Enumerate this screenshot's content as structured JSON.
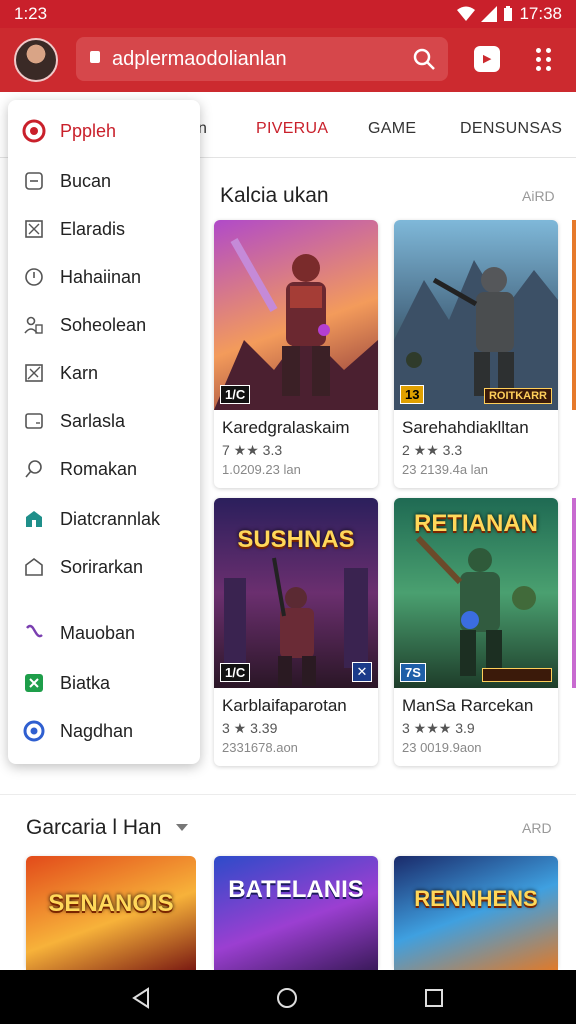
{
  "status": {
    "time_left": "1:23",
    "time_right": "17:38"
  },
  "appbar": {
    "url": "adplermaodolianlan",
    "store_label": ""
  },
  "tabs": [
    {
      "label": "PIVERUA"
    },
    {
      "label": "GAME"
    },
    {
      "label": "DENSUNSAS"
    }
  ],
  "tab_partial": "n",
  "section1": {
    "title": "Kalcia ukan",
    "more": "AiRD"
  },
  "section2": {
    "title": "Garcaria l Han",
    "more": "ARD"
  },
  "cards": [
    {
      "name": "Karedgralaskaim",
      "rating": "7 ★★ 3.3",
      "meta": "1.0209.23 lan",
      "badge": "1/C",
      "badge2": ""
    },
    {
      "name": "Sarehahdiaklltan",
      "rating": "2 ★★ 3.3",
      "meta": "23 2139.4a lan",
      "badge": "13",
      "badge2": "ROITKARR"
    },
    {
      "name": "Karblaifaparotan",
      "rating": "3 ★ 3.39",
      "meta": "2331678.aon",
      "badge": "1/C",
      "badge2": "",
      "art_title": "SUSHNAS"
    },
    {
      "name": "ManSa Rarcekan",
      "rating": "3 ★★★ 3.9",
      "meta": "23 0019.9aon",
      "badge": "7S",
      "badge2": "",
      "art_title": "RETIANAN"
    },
    {
      "art_title": "SENANOIS"
    },
    {
      "art_title": "BATELANIS"
    },
    {
      "art_title": "RENNHENS"
    }
  ],
  "drawer": {
    "items": [
      {
        "label": "Pppleh",
        "icon": "brand-icon"
      },
      {
        "label": "Bucan",
        "icon": "bookmark-icon"
      },
      {
        "label": "Elaradis",
        "icon": "box-icon"
      },
      {
        "label": "Hahaiinan",
        "icon": "shield-icon"
      },
      {
        "label": "Soheolean",
        "icon": "people-icon"
      },
      {
        "label": "Karn",
        "icon": "crossbox-icon"
      },
      {
        "label": "Sarlasla",
        "icon": "window-icon"
      },
      {
        "label": "Romakan",
        "icon": "search-icon"
      },
      {
        "label": "Diatcrannlak",
        "icon": "building-icon"
      },
      {
        "label": "Sorirarkan",
        "icon": "home-icon"
      },
      {
        "label": "Mauoban",
        "icon": "link-icon"
      },
      {
        "label": "Biatka",
        "icon": "sheet-icon"
      },
      {
        "label": "Nagdhan",
        "icon": "circle-icon"
      }
    ]
  },
  "colors": {
    "brand": "#cc2a2f",
    "accent_star": "#f2a600"
  }
}
